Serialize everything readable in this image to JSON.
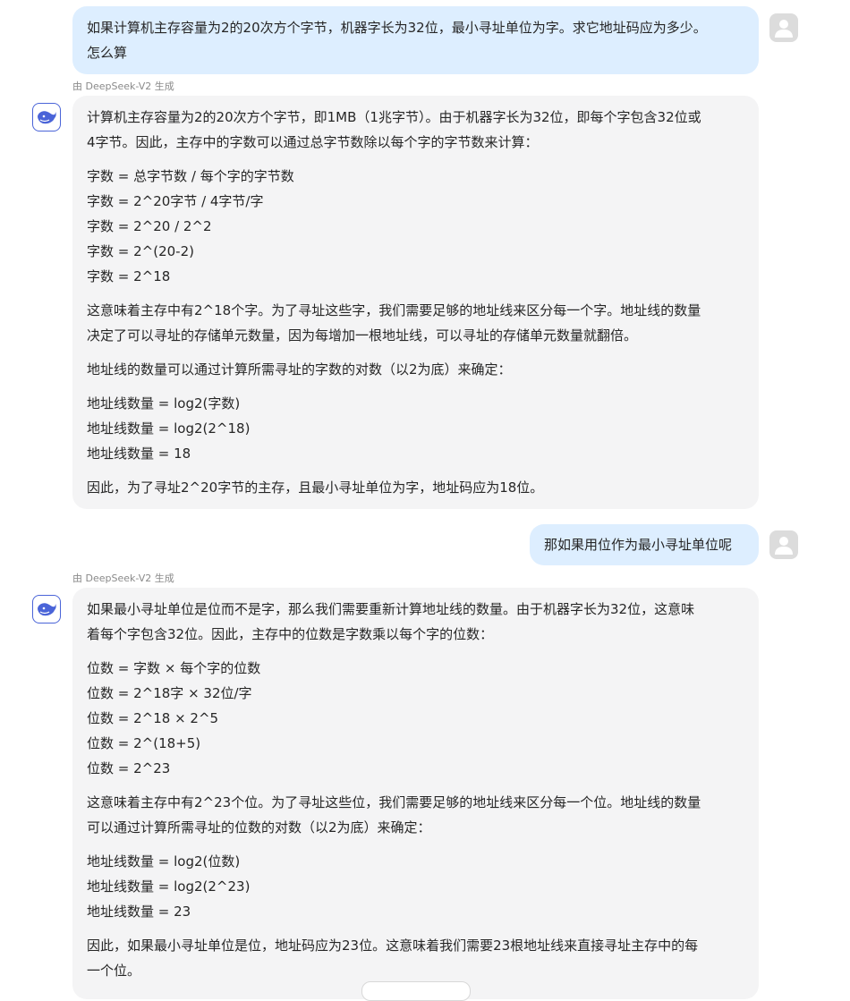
{
  "conversation": {
    "q1": {
      "line1": "如果计算机主存容量为2的20次方个字节，机器字长为32位，最小寻址单位为字。求它地址码应为多少。",
      "line2": "怎么算"
    },
    "a1": {
      "model_tag": "由 DeepSeek-V2 生成",
      "p1_l1": "计算机主存容量为2的20次方个字节，即1MB（1兆字节）。由于机器字长为32位，即每个字包含32位或",
      "p1_l2": "4字节。因此，主存中的字数可以通过总字节数除以每个字的字节数来计算：",
      "calc1": [
        "字数 = 总字节数 / 每个字的字节数",
        "字数 = 2^20字节 / 4字节/字",
        "字数 = 2^20 / 2^2",
        "字数 = 2^(20-2)",
        "字数 = 2^18"
      ],
      "p2_l1": "这意味着主存中有2^18个字。为了寻址这些字，我们需要足够的地址线来区分每一个字。地址线的数量",
      "p2_l2": "决定了可以寻址的存储单元数量，因为每增加一根地址线，可以寻址的存储单元数量就翻倍。",
      "p3": "地址线的数量可以通过计算所需寻址的字数的对数（以2为底）来确定：",
      "calc2": [
        "地址线数量 = log2(字数)",
        "地址线数量 = log2(2^18)",
        "地址线数量 = 18"
      ],
      "p4": "因此，为了寻址2^20字节的主存，且最小寻址单位为字，地址码应为18位。"
    },
    "q2": {
      "text": "那如果用位作为最小寻址单位呢"
    },
    "a2": {
      "model_tag": "由 DeepSeek-V2 生成",
      "p1_l1": "如果最小寻址单位是位而不是字，那么我们需要重新计算地址线的数量。由于机器字长为32位，这意味",
      "p1_l2": "着每个字包含32位。因此，主存中的位数是字数乘以每个字的位数：",
      "calc1": [
        "位数 = 字数 × 每个字的位数",
        "位数 = 2^18字 × 32位/字",
        "位数 = 2^18 × 2^5",
        "位数 = 2^(18+5)",
        "位数 = 2^23"
      ],
      "p2_l1": "这意味着主存中有2^23个位。为了寻址这些位，我们需要足够的地址线来区分每一个位。地址线的数量",
      "p2_l2": "可以通过计算所需寻址的位数的对数（以2为底）来确定：",
      "calc2": [
        "地址线数量 = log2(位数)",
        "地址线数量 = log2(2^23)",
        "地址线数量 = 23"
      ],
      "p3_l1": "因此，如果最小寻址单位是位，地址码应为23位。这意味着我们需要23根地址线来直接寻址主存中的每",
      "p3_l2": "一个位。"
    }
  },
  "icons": {
    "user_avatar": "user-silhouette-icon",
    "bot_avatar": "deepseek-whale-icon"
  },
  "colors": {
    "user_bubble": "#ddeeff",
    "bot_bubble": "#f4f4f5",
    "brand": "#4a64d8"
  }
}
